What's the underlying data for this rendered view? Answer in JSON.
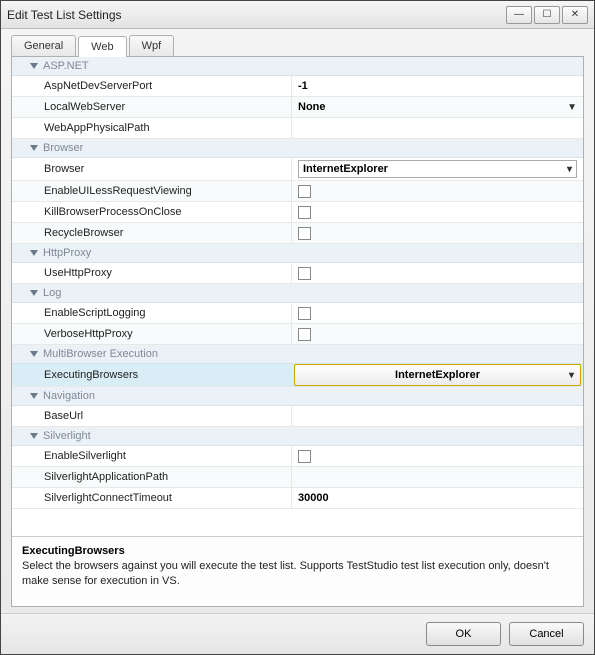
{
  "window": {
    "title": "Edit Test List Settings"
  },
  "tabs": {
    "general": "General",
    "web": "Web",
    "wpf": "Wpf",
    "active": "web"
  },
  "groups": {
    "aspnet": {
      "label": "ASP.NET",
      "props": {
        "AspNetDevServerPort": {
          "label": "AspNetDevServerPort",
          "value": "-1"
        },
        "LocalWebServer": {
          "label": "LocalWebServer",
          "value": "None"
        },
        "WebAppPhysicalPath": {
          "label": "WebAppPhysicalPath",
          "value": ""
        }
      }
    },
    "browser": {
      "label": "Browser",
      "props": {
        "Browser": {
          "label": "Browser",
          "value": "InternetExplorer"
        },
        "EnableUILessRequestViewing": {
          "label": "EnableUILessRequestViewing",
          "checked": false
        },
        "KillBrowserProcessOnClose": {
          "label": "KillBrowserProcessOnClose",
          "checked": false
        },
        "RecycleBrowser": {
          "label": "RecycleBrowser",
          "checked": false
        }
      }
    },
    "httpproxy": {
      "label": "HttpProxy",
      "props": {
        "UseHttpProxy": {
          "label": "UseHttpProxy",
          "checked": false
        }
      }
    },
    "log": {
      "label": "Log",
      "props": {
        "EnableScriptLogging": {
          "label": "EnableScriptLogging",
          "checked": false
        },
        "VerboseHttpProxy": {
          "label": "VerboseHttpProxy",
          "checked": false
        }
      }
    },
    "multibrowser": {
      "label": "MultiBrowser Execution",
      "props": {
        "ExecutingBrowsers": {
          "label": "ExecutingBrowsers",
          "value": "InternetExplorer"
        }
      }
    },
    "navigation": {
      "label": "Navigation",
      "props": {
        "BaseUrl": {
          "label": "BaseUrl",
          "value": ""
        }
      }
    },
    "silverlight": {
      "label": "Silverlight",
      "props": {
        "EnableSilverlight": {
          "label": "EnableSilverlight",
          "checked": false
        },
        "SilverlightApplicationPath": {
          "label": "SilverlightApplicationPath",
          "value": ""
        },
        "SilverlightConnectTimeout": {
          "label": "SilverlightConnectTimeout",
          "value": "30000"
        }
      }
    }
  },
  "desc": {
    "title": "ExecutingBrowsers",
    "body": "Select the browsers against you will execute the test list. Supports TestStudio test list execution only, doesn't make sense for execution in VS."
  },
  "footer": {
    "ok": "OK",
    "cancel": "Cancel"
  }
}
